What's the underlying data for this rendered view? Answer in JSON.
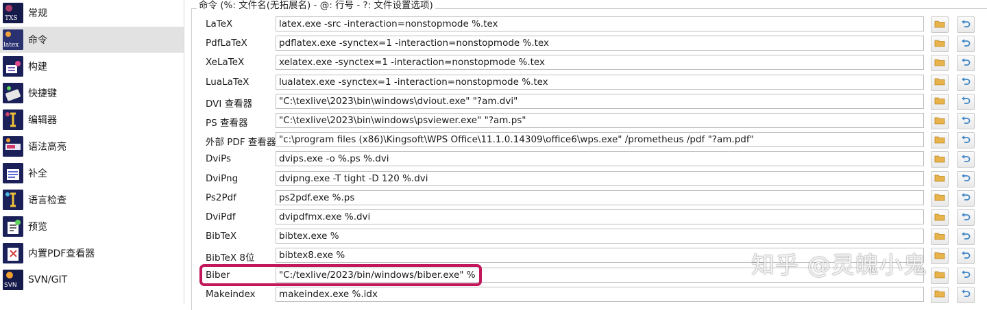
{
  "sidebar": {
    "items": [
      {
        "label": "常规",
        "icon": "txs-icon",
        "icon_text": "TXS"
      },
      {
        "label": "命令",
        "icon": "latex-icon",
        "icon_text": "latex",
        "selected": true
      },
      {
        "label": "构建",
        "icon": "build-icon"
      },
      {
        "label": "快捷键",
        "icon": "keyboard-icon"
      },
      {
        "label": "编辑器",
        "icon": "editor-icon"
      },
      {
        "label": "语法高亮",
        "icon": "syntax-highlight-icon"
      },
      {
        "label": "补全",
        "icon": "completion-icon"
      },
      {
        "label": "语言检查",
        "icon": "language-check-icon"
      },
      {
        "label": "预览",
        "icon": "preview-icon"
      },
      {
        "label": "内置PDF查看器",
        "icon": "pdf-viewer-icon"
      },
      {
        "label": "SVN/GIT",
        "icon": "svn-icon",
        "icon_text": "SVN"
      }
    ]
  },
  "commands": {
    "group_title": "命令 (%: 文件名(无拓展名) - @: 行号 - ?: 文件设置选项)",
    "rows": [
      {
        "label": "LaTeX",
        "value": "latex.exe -src -interaction=nonstopmode %.tex"
      },
      {
        "label": "PdfLaTeX",
        "value": "pdflatex.exe -synctex=1 -interaction=nonstopmode %.tex"
      },
      {
        "label": "XeLaTeX",
        "value": "xelatex.exe -synctex=1 -interaction=nonstopmode %.tex"
      },
      {
        "label": "LuaLaTeX",
        "value": "lualatex.exe -synctex=1 -interaction=nonstopmode %.tex"
      },
      {
        "label": "DVI 查看器",
        "value": "\"C:\\texlive\\2023\\bin\\windows\\dviout.exe\" \"?am.dvi\""
      },
      {
        "label": "PS 查看器",
        "value": "\"C:\\texlive\\2023\\bin\\windows\\psviewer.exe\" \"?am.ps\""
      },
      {
        "label": "外部 PDF 查看器",
        "value": "\"c:\\program files (x86)\\Kingsoft\\WPS Office\\11.1.0.14309\\office6\\wps.exe\" /prometheus /pdf \"?am.pdf\""
      },
      {
        "label": "DviPs",
        "value": "dvips.exe -o %.ps %.dvi"
      },
      {
        "label": "DviPng",
        "value": "dvipng.exe -T tight -D 120 %.dvi"
      },
      {
        "label": "Ps2Pdf",
        "value": "ps2pdf.exe %.ps"
      },
      {
        "label": "DviPdf",
        "value": "dvipdfmx.exe %.dvi"
      },
      {
        "label": "BibTeX",
        "value": "bibtex.exe %"
      },
      {
        "label": "BibTeX 8位",
        "value": "bibtex8.exe %"
      },
      {
        "label": "Biber",
        "value": "\"C:/texlive/2023/bin/windows/biber.exe\" %"
      },
      {
        "label": "Makeindex",
        "value": "makeindex.exe %.idx"
      }
    ]
  },
  "watermark": "知乎 @灵魄小鬼",
  "colors": {
    "highlight": "#c2185b",
    "selected_bg": "#e2e2e2",
    "folder": "#e8b34a",
    "reset": "#3f86c6"
  }
}
